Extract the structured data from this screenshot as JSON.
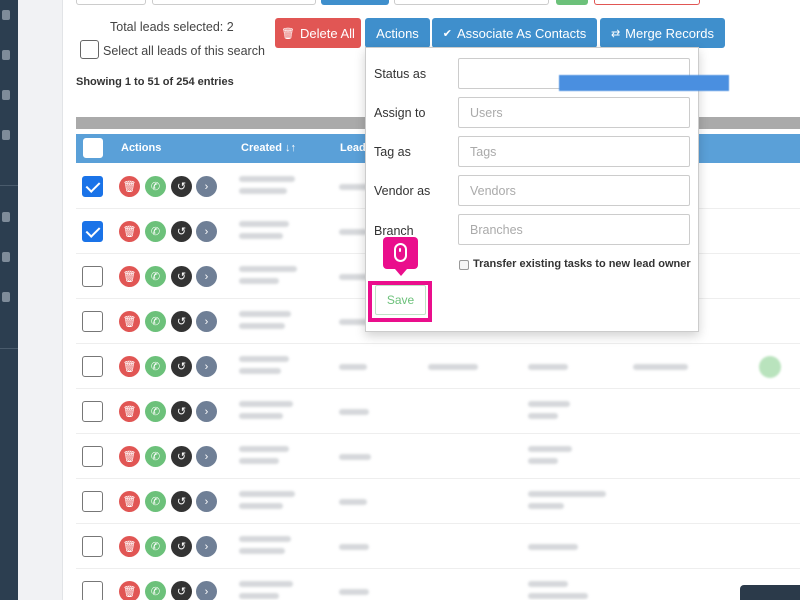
{
  "selection": {
    "total_selected": "Total leads selected: 2",
    "select_all_label": "Select all leads of this search"
  },
  "toolbar": {
    "delete_all": "Delete All",
    "actions": "Actions",
    "associate_contacts": "Associate As Contacts",
    "merge_records": "Merge Records"
  },
  "showing_text": "Showing 1 to 51 of 254 entries",
  "table": {
    "headers": [
      "Actions",
      "Created",
      "Lead"
    ],
    "rows": [
      {
        "checked": true
      },
      {
        "checked": true
      },
      {
        "checked": false
      },
      {
        "checked": false
      },
      {
        "checked": false
      },
      {
        "checked": false
      },
      {
        "checked": false
      },
      {
        "checked": false
      },
      {
        "checked": false
      },
      {
        "checked": false
      }
    ]
  },
  "actions_panel": {
    "status_label": "Status as",
    "assign_label": "Assign to",
    "assign_placeholder": "Users",
    "tag_label": "Tag as",
    "tag_placeholder": "Tags",
    "vendor_label": "Vendor as",
    "vendor_placeholder": "Vendors",
    "branch_label": "Branch",
    "branch_placeholder": "Branches",
    "transfer_label": "Transfer existing tasks to new lead owner",
    "save_label": "Save"
  },
  "colors": {
    "delete": "#e15654",
    "primary": "#3f8fcc",
    "header": "#5aa0d8",
    "highlight": "#ea0e8c",
    "save": "#6cc17a"
  }
}
